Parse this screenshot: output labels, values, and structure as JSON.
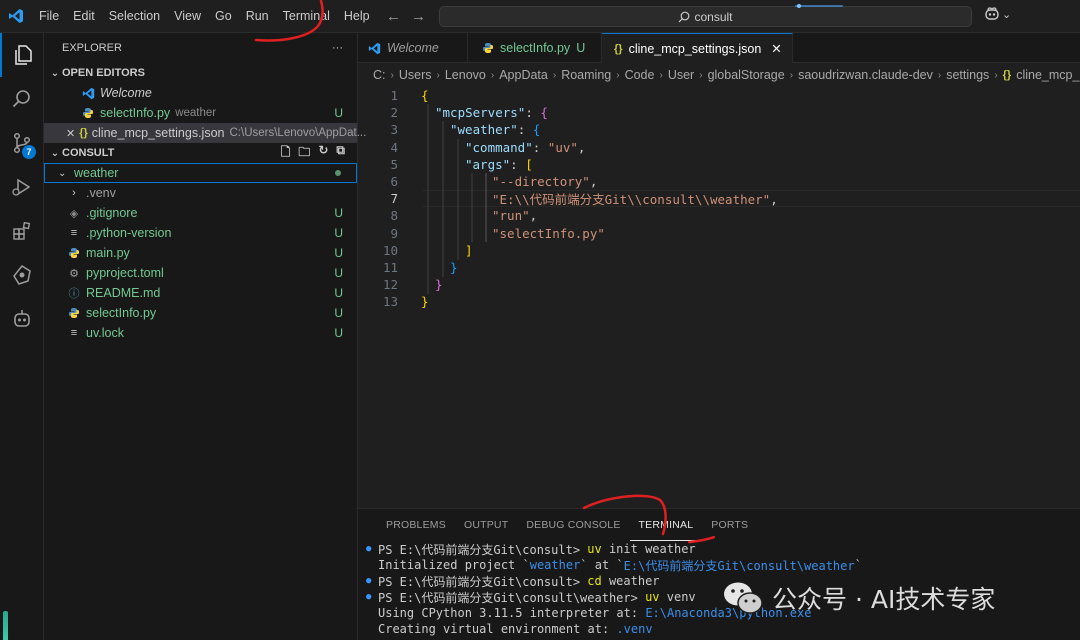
{
  "menu": [
    "File",
    "Edit",
    "Selection",
    "View",
    "Go",
    "Run",
    "Terminal",
    "Help"
  ],
  "search": {
    "value": "consult"
  },
  "sidebar": {
    "title": "EXPLORER",
    "open_editors": {
      "label": "OPEN EDITORS",
      "items": [
        {
          "name": "Welcome",
          "desc": "",
          "status": ""
        },
        {
          "name": "selectInfo.py",
          "desc": "weather",
          "status": "U"
        },
        {
          "name": "cline_mcp_settings.json",
          "desc": "C:\\Users\\Lenovo\\AppDat...",
          "status": ""
        }
      ]
    },
    "consult": {
      "label": "CONSULT",
      "folder": "weather",
      "items": [
        {
          "name": ".venv",
          "status": ""
        },
        {
          "name": ".gitignore",
          "status": "U"
        },
        {
          "name": ".python-version",
          "status": "U"
        },
        {
          "name": "main.py",
          "status": "U"
        },
        {
          "name": "pyproject.toml",
          "status": "U"
        },
        {
          "name": "README.md",
          "status": "U"
        },
        {
          "name": "selectInfo.py",
          "status": "U"
        },
        {
          "name": "uv.lock",
          "status": "U"
        }
      ]
    }
  },
  "tabs": [
    {
      "label": "Welcome",
      "badge": ""
    },
    {
      "label": "selectInfo.py",
      "badge": "U"
    },
    {
      "label": "cline_mcp_settings.json",
      "badge": ""
    }
  ],
  "breadcrumbs": [
    "C:",
    "Users",
    "Lenovo",
    "AppData",
    "Roaming",
    "Code",
    "User",
    "globalStorage",
    "saoudrizwan.claude-dev",
    "settings",
    "cline_mcp_settin"
  ],
  "editor": {
    "line_numbers": [
      "1",
      "2",
      "3",
      "4",
      "5",
      "6",
      "7",
      "8",
      "9",
      "10",
      "11",
      "12",
      "13"
    ],
    "current_line": 7,
    "code": {
      "l1": "{",
      "l2_key": "\"mcpServers\"",
      "l2_rest": ": ",
      "l2_brace": "{",
      "l3_key": "\"weather\"",
      "l3_rest": ": ",
      "l3_brace": "{",
      "l4_key": "\"command\"",
      "l4_val": "\"uv\"",
      "l5_key": "\"args\"",
      "l5_bracket": "[",
      "l6": "\"--directory\"",
      "l7": "\"E:\\\\代码前端分支Git\\\\consult\\\\weather\"",
      "l8": "\"run\"",
      "l9": "\"selectInfo.py\"",
      "l10": "]",
      "l11": "}",
      "l12": "}",
      "l13": "}"
    }
  },
  "panel": {
    "tabs": [
      "PROBLEMS",
      "OUTPUT",
      "DEBUG CONSOLE",
      "TERMINAL",
      "PORTS"
    ],
    "terminal": {
      "t1_prompt": "PS E:\\代码前端分支Git\\consult> ",
      "t1_cmd": "uv",
      "t1_args": " init weather",
      "t2_a": "Initialized project `",
      "t2_b": "weather",
      "t2_c": "` at `",
      "t2_d": "E:\\代码前端分支Git\\consult\\weather",
      "t2_e": "`",
      "t3_prompt": "PS E:\\代码前端分支Git\\consult> ",
      "t3_cmd": "cd",
      "t3_args": " weather",
      "t4_prompt": "PS E:\\代码前端分支Git\\consult\\weather> ",
      "t4_cmd": "uv",
      "t4_args": " venv",
      "t5_a": "Using CPython 3.11.5 interpreter at: ",
      "t5_b": "E:\\Anaconda3\\python.exe",
      "t6_a": "Creating virtual environment at: ",
      "t6_b": ".venv"
    }
  },
  "watermark": {
    "text": "公众号 · AI技术专家"
  },
  "colors": {
    "accent": "#0078d4",
    "untracked": "#73c991",
    "annotation": "#e02020"
  }
}
